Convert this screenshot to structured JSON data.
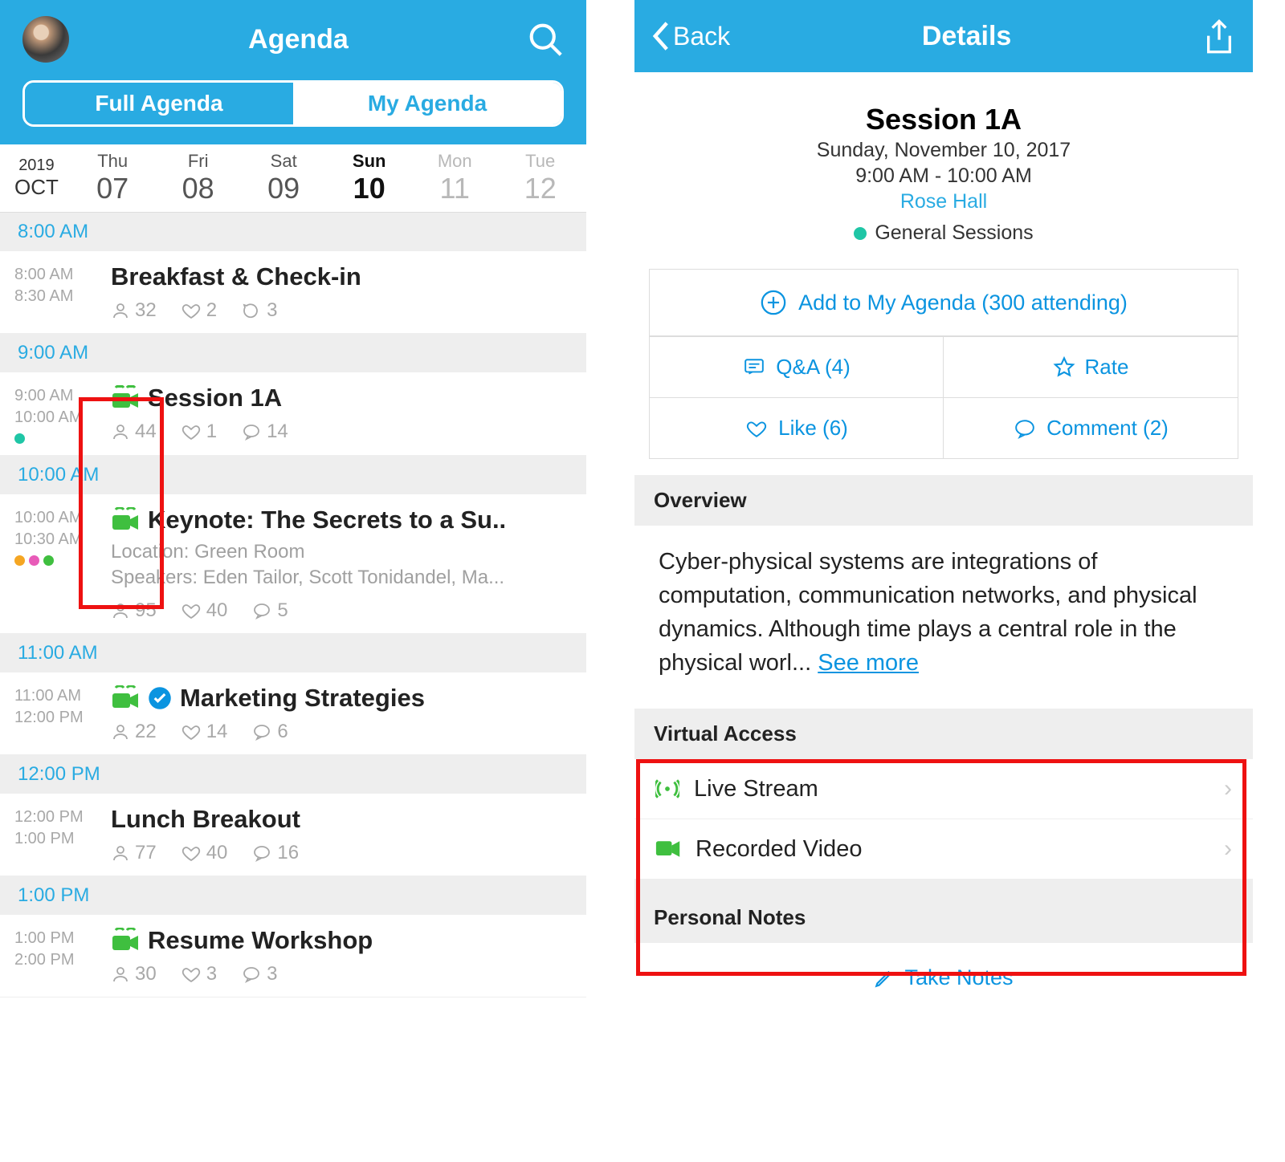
{
  "left": {
    "title": "Agenda",
    "tabs": {
      "full": "Full Agenda",
      "mine": "My Agenda"
    },
    "anchor": {
      "year": "2019",
      "month": "OCT"
    },
    "days": [
      {
        "name": "Thu",
        "num": "07"
      },
      {
        "name": "Fri",
        "num": "08"
      },
      {
        "name": "Sat",
        "num": "09"
      },
      {
        "name": "Sun",
        "num": "10"
      },
      {
        "name": "Mon",
        "num": "11"
      },
      {
        "name": "Tue",
        "num": "12"
      }
    ],
    "slots": {
      "h8": "8:00 AM",
      "h9": "9:00 AM",
      "h10": "10:00 AM",
      "h11": "11:00 AM",
      "h12": "12:00 PM",
      "h13": "1:00 PM"
    },
    "events": {
      "breakfast": {
        "start": "8:00 AM",
        "end": "8:30 AM",
        "title": "Breakfast & Check-in",
        "people": "32",
        "likes": "2",
        "comments": "3"
      },
      "s1a": {
        "start": "9:00 AM",
        "end": "10:00 AM",
        "title": "Session 1A",
        "people": "44",
        "likes": "1",
        "comments": "14"
      },
      "keynote": {
        "start": "10:00 AM",
        "end": "10:30 AM",
        "title": "Keynote: The Secrets to a Su..",
        "loc": "Location: Green Room",
        "speakers": "Speakers: Eden Tailor, Scott Tonidandel, Ma...",
        "people": "95",
        "likes": "40",
        "comments": "5"
      },
      "marketing": {
        "start": "11:00 AM",
        "end": "12:00 PM",
        "title": "Marketing Strategies",
        "people": "22",
        "likes": "14",
        "comments": "6"
      },
      "lunch": {
        "start": "12:00 PM",
        "end": "1:00 PM",
        "title": "Lunch Breakout",
        "people": "77",
        "likes": "40",
        "comments": "16"
      },
      "resume": {
        "start": "1:00 PM",
        "end": "2:00 PM",
        "title": "Resume Workshop",
        "people": "30",
        "likes": "3",
        "comments": "3"
      }
    }
  },
  "right": {
    "back": "Back",
    "title": "Details",
    "session": {
      "name": "Session 1A",
      "date": "Sunday, November 10, 2017",
      "time": "9:00 AM - 10:00 AM",
      "location": "Rose Hall",
      "track": "General Sessions"
    },
    "actions": {
      "add": "Add to My Agenda (300 attending)",
      "qa": "Q&A (4)",
      "rate": "Rate",
      "like": "Like (6)",
      "comment": "Comment (2)"
    },
    "overview_head": "Overview",
    "overview_body": "Cyber-physical systems are integrations of computation, communication networks, and physical dynamics. Although time plays a central role in the physical worl...   ",
    "see_more": "See more",
    "virtual_head": "Virtual Access",
    "virtual": {
      "live": "Live Stream",
      "recorded": "Recorded Video"
    },
    "notes_head": "Personal Notes",
    "take_notes": "Take Notes"
  }
}
